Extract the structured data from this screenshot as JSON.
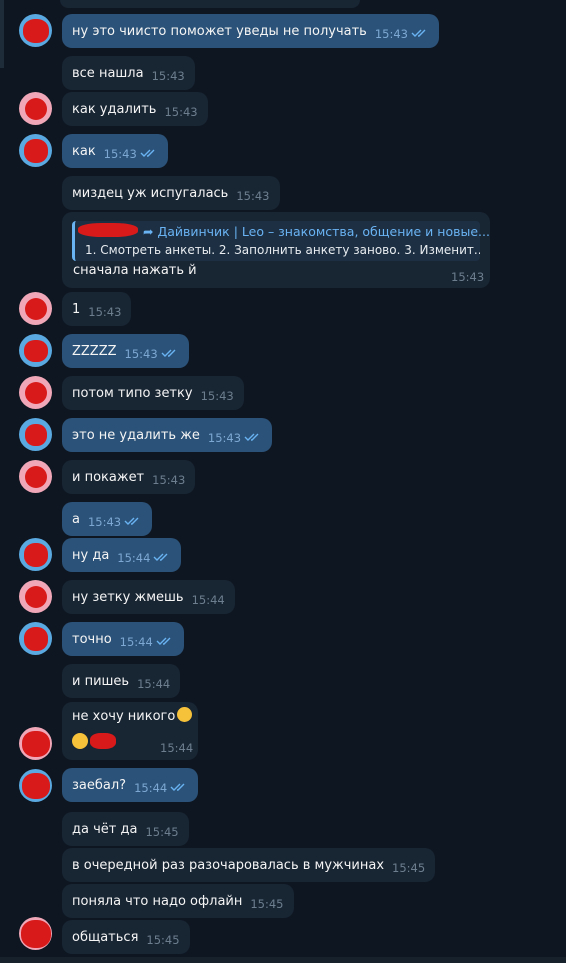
{
  "messages": [
    {
      "text": "ну это чиисто поможет уведы не получать",
      "time": "15:43",
      "dir": "out"
    },
    {
      "text": "все нашла",
      "time": "15:43",
      "dir": "in"
    },
    {
      "text": "как удалить",
      "time": "15:43",
      "dir": "in"
    },
    {
      "text": "как",
      "time": "15:43",
      "dir": "out"
    },
    {
      "text": "миздец уж испугалась",
      "time": "15:43",
      "dir": "in"
    },
    {
      "text": "1",
      "time": "15:43",
      "dir": "in"
    },
    {
      "text": "ZZZZZ",
      "time": "15:43",
      "dir": "out"
    },
    {
      "text": "потом типо зетку",
      "time": "15:43",
      "dir": "in"
    },
    {
      "text": "это не удалить же",
      "time": "15:43",
      "dir": "out"
    },
    {
      "text": "и покажет",
      "time": "15:43",
      "dir": "in"
    },
    {
      "text": "а",
      "time": "15:43",
      "dir": "out"
    },
    {
      "text": "ну да",
      "time": "15:44",
      "dir": "out"
    },
    {
      "text": "ну зетку жмешь",
      "time": "15:44",
      "dir": "in"
    },
    {
      "text": "точно",
      "time": "15:44",
      "dir": "out"
    },
    {
      "text": "и пишеь",
      "time": "15:44",
      "dir": "in"
    },
    {
      "text": "заебал?",
      "time": "15:44",
      "dir": "out"
    },
    {
      "text": "да чёт да",
      "time": "15:45",
      "dir": "in"
    },
    {
      "text": "в очередной раз разочаровалась в мужчинах",
      "time": "15:45",
      "dir": "in"
    },
    {
      "text": "поняла что надо офлайн",
      "time": "15:45",
      "dir": "in"
    },
    {
      "text": "общаться",
      "time": "15:45",
      "dir": "in"
    }
  ],
  "forward": {
    "title": "Дайвинчик | Leo – знакомства, общение и новые...",
    "preview": "1. Смотреть анкеты. 2. Заполнить анкету заново. 3. Изменит...",
    "caption": "сначала нажать й",
    "time": "15:43"
  },
  "emoji_message": {
    "text": "не хочу никого",
    "time": "15:44"
  },
  "colors": {
    "background": "#0e1621",
    "incoming_bubble": "#182533",
    "outgoing_bubble": "#2b5278",
    "accent": "#6ab3f3",
    "read_ticks": "#6ab3f3"
  }
}
